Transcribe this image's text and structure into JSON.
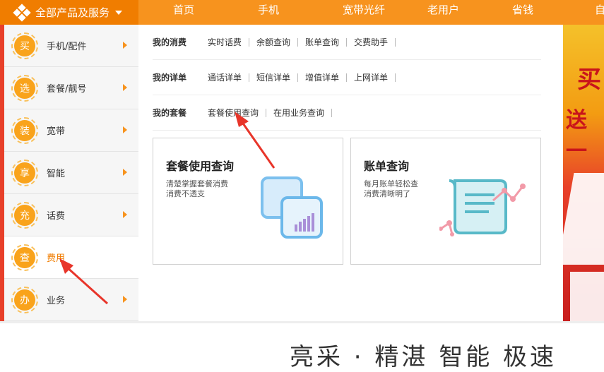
{
  "topbar": {
    "all_products": "全部产品及服务",
    "nav": [
      "首页",
      "手机",
      "宽带光纤",
      "老用户",
      "省钱",
      "自"
    ]
  },
  "sidebar": {
    "items": [
      {
        "badge": "买",
        "label": "手机/配件"
      },
      {
        "badge": "选",
        "label": "套餐/靓号"
      },
      {
        "badge": "装",
        "label": "宽带"
      },
      {
        "badge": "享",
        "label": "智能"
      },
      {
        "badge": "充",
        "label": "话费"
      },
      {
        "badge": "查",
        "label": "费用"
      },
      {
        "badge": "办",
        "label": "业务"
      }
    ]
  },
  "panel": {
    "rows": [
      {
        "title": "我的消费",
        "links": [
          "实时话费",
          "余额查询",
          "账单查询",
          "交费助手"
        ]
      },
      {
        "title": "我的详单",
        "links": [
          "通话详单",
          "短信详单",
          "增值详单",
          "上网详单"
        ]
      },
      {
        "title": "我的套餐",
        "links": [
          "套餐使用查询",
          "在用业务查询"
        ]
      }
    ],
    "cards": [
      {
        "title": "套餐使用查询",
        "line1": "清楚掌握套餐消费",
        "line2": "消费不透支"
      },
      {
        "title": "账单查询",
        "line1": "每月账单轻松查",
        "line2": "消费清晰明了"
      }
    ]
  },
  "banner": {
    "line1": "买",
    "line2": "送一"
  },
  "footer_text": "亮采 · 精湛 智能 极速",
  "colors": {
    "brand_orange": "#f7931e",
    "badge_orange": "#f9a31b",
    "annotation_red": "#e8352a"
  }
}
